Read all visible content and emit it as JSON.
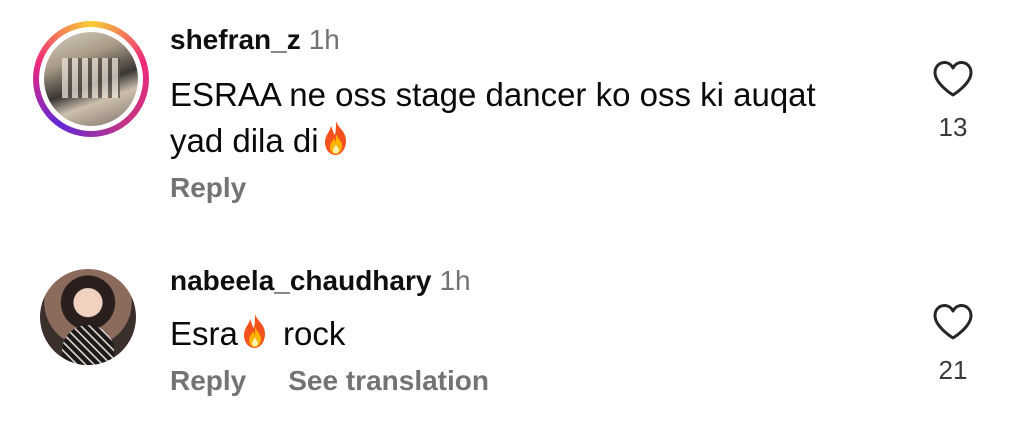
{
  "comments": [
    {
      "username": "shefran_z",
      "time": "1h",
      "text_before": "ESRAA ne oss stage dancer ko oss ki auqat yad dila di",
      "emoji": "fire-emoji",
      "text_after": "",
      "likes": "13",
      "reply_label": "Reply",
      "has_story_ring": true
    },
    {
      "username": "nabeela_chaudhary",
      "time": "1h",
      "text_before": "Esra",
      "emoji": "fire-emoji",
      "text_after": " rock",
      "likes": "21",
      "reply_label": "Reply",
      "see_translation_label": "See translation",
      "has_story_ring": false
    }
  ],
  "icons": {
    "like": "heart-outline-icon"
  },
  "colors": {
    "secondary_text": "#737373",
    "story_ring": [
      "#f9ce34",
      "#ee2a7b",
      "#6228d7"
    ]
  }
}
